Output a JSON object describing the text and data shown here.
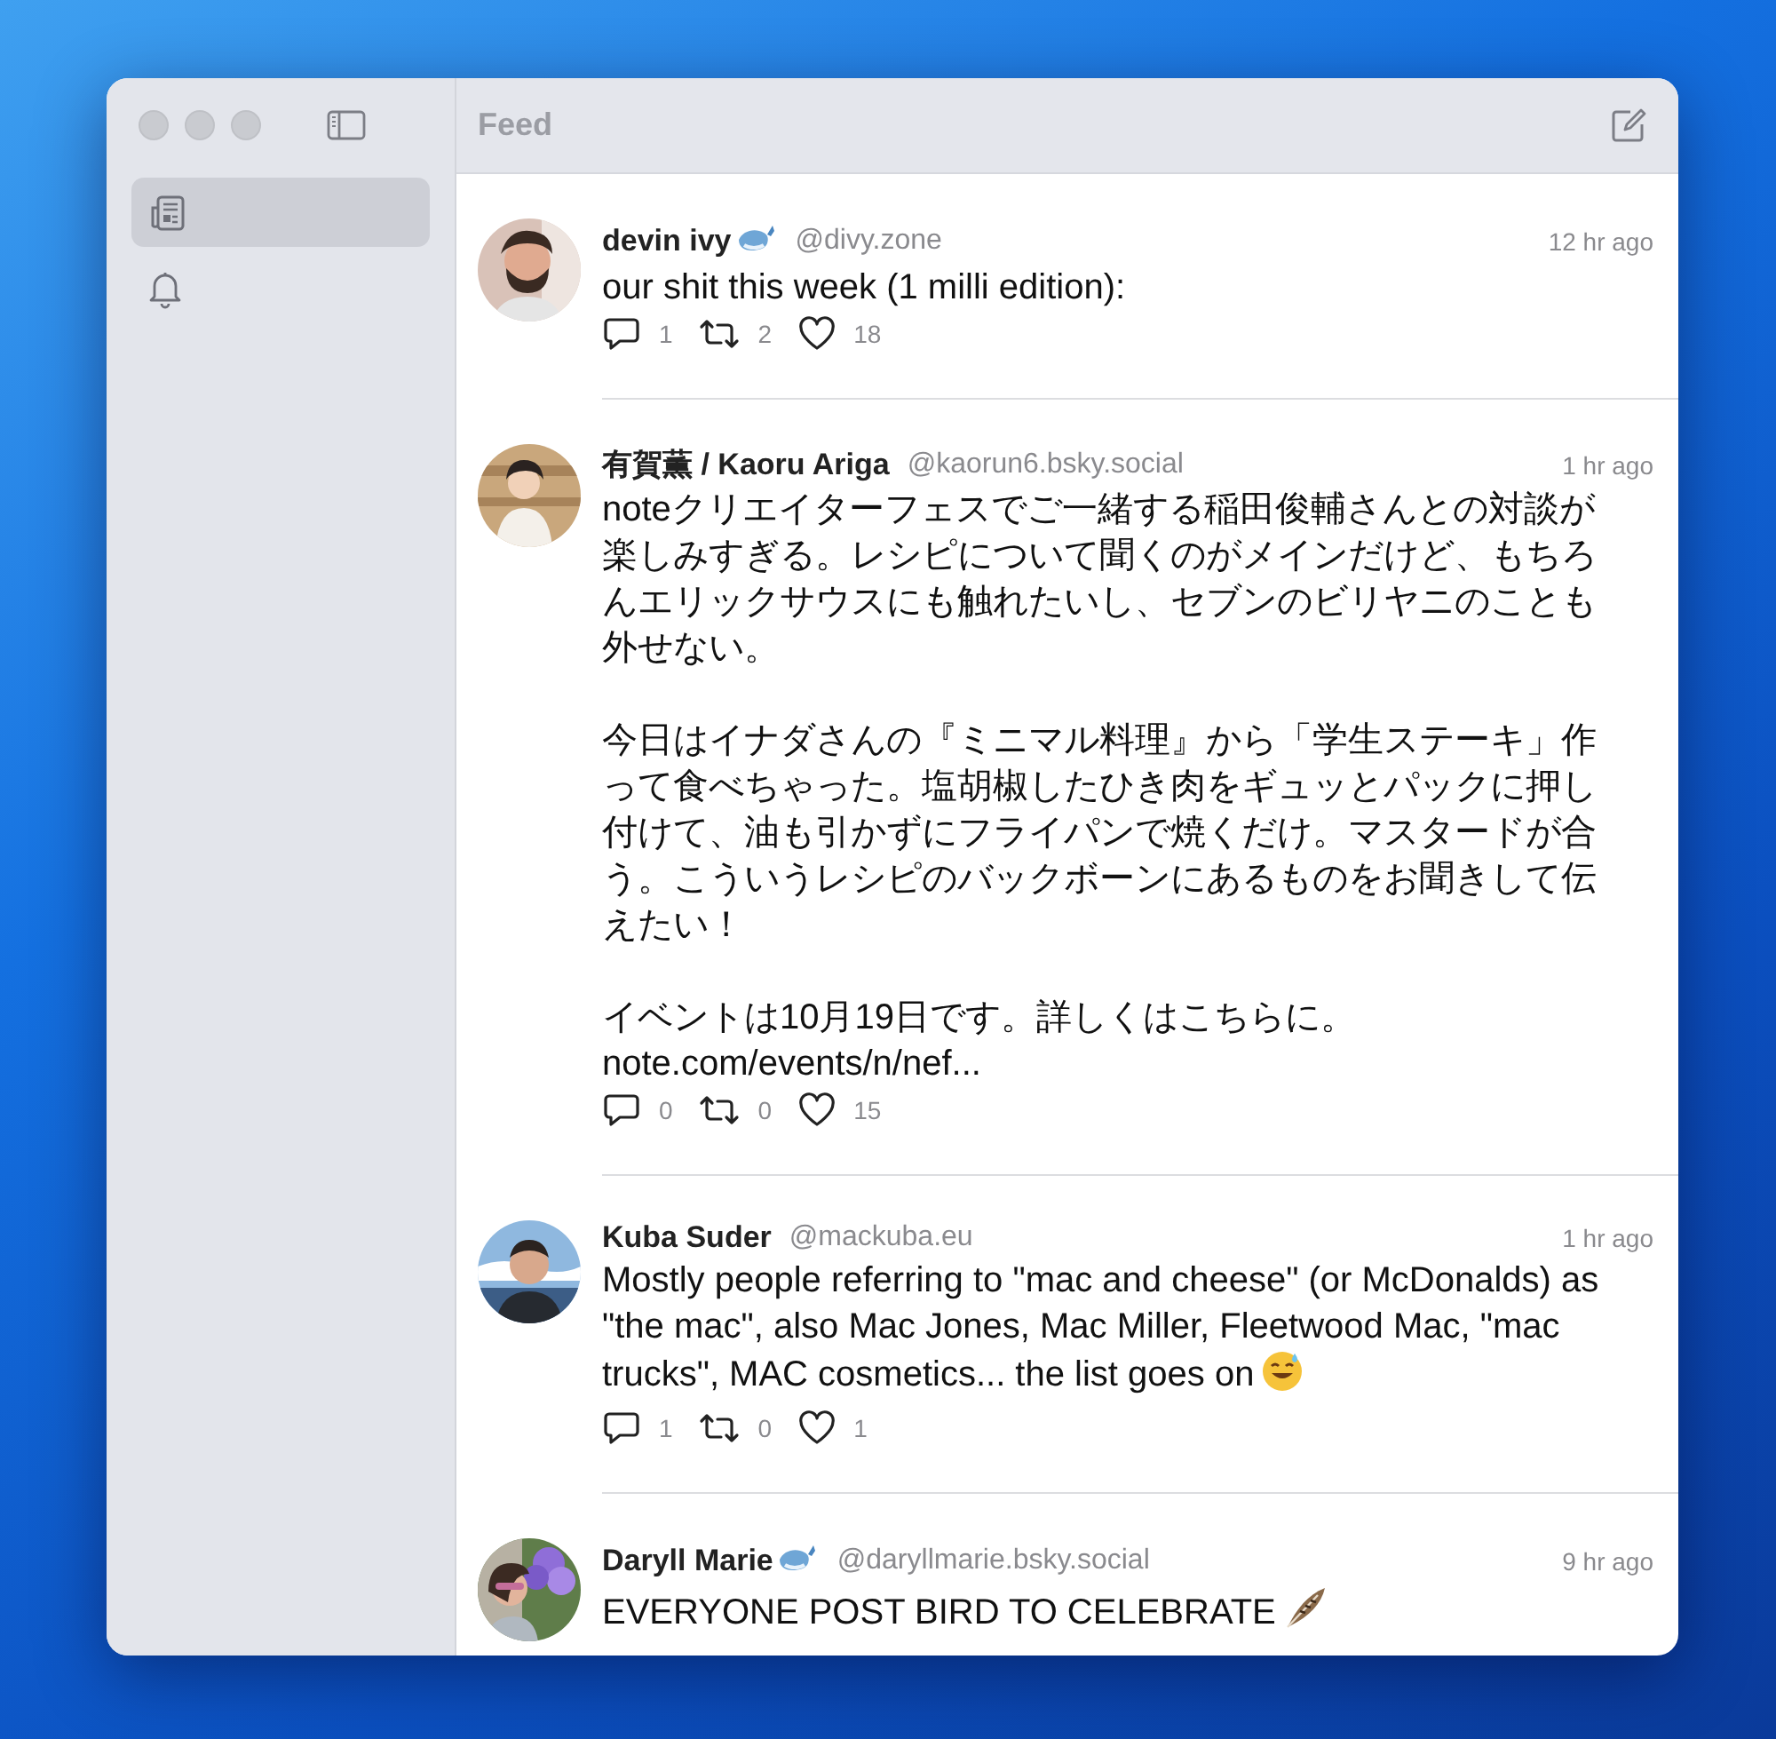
{
  "sidebar": {
    "items": [
      {
        "kind": "feed",
        "selected": true
      },
      {
        "kind": "notifications",
        "selected": false
      }
    ]
  },
  "header": {
    "title": "Feed"
  },
  "posts": [
    {
      "name": "devin ivy",
      "name_badge": true,
      "handle": "@divy.zone",
      "time": "12 hr ago",
      "paragraphs": [
        "our shit this week (1 milli edition):"
      ],
      "trailing_emoji": false,
      "replies": "1",
      "reposts": "2",
      "likes": "18"
    },
    {
      "name": "有賀薫 / Kaoru Ariga",
      "name_badge": false,
      "handle": "@kaorun6.bsky.social",
      "time": "1 hr ago",
      "paragraphs": [
        "noteクリエイターフェスでご一緒する稲田俊輔さんとの対談が楽しみすぎる。レシピについて聞くのがメインだけど、もちろんエリックサウスにも触れたいし、セブンのビリヤニのことも外せない。",
        "今日はイナダさんの『ミニマル料理』から「学生ステーキ」作って食べちゃった。塩胡椒したひき肉をギュッとパックに押し付けて、油も引かずにフライパンで焼くだけ。マスタードが合う。こういうレシピのバックボーンにあるものをお聞きして伝えたい！",
        "イベントは10月19日です。詳しくはこちらに。"
      ],
      "link": "note.com/events/n/nef...",
      "trailing_emoji": false,
      "replies": "0",
      "reposts": "0",
      "likes": "15"
    },
    {
      "name": "Kuba Suder",
      "name_badge": false,
      "handle": "@mackuba.eu",
      "time": "1 hr ago",
      "paragraphs": [
        "Mostly people referring to \"mac and cheese\" (or McDonalds) as \"the mac\", also Mac Jones, Mac Miller, Fleetwood Mac, \"mac trucks\", MAC cosmetics... the list goes on"
      ],
      "trailing_emoji": true,
      "replies": "1",
      "reposts": "0",
      "likes": "1"
    },
    {
      "name": "Daryll Marie",
      "name_badge": true,
      "handle": "@daryllmarie.bsky.social",
      "time": "9 hr ago",
      "paragraphs": [
        "EVERYONE POST BIRD TO CELEBRATE"
      ],
      "trailing_emoji": true
    }
  ]
}
